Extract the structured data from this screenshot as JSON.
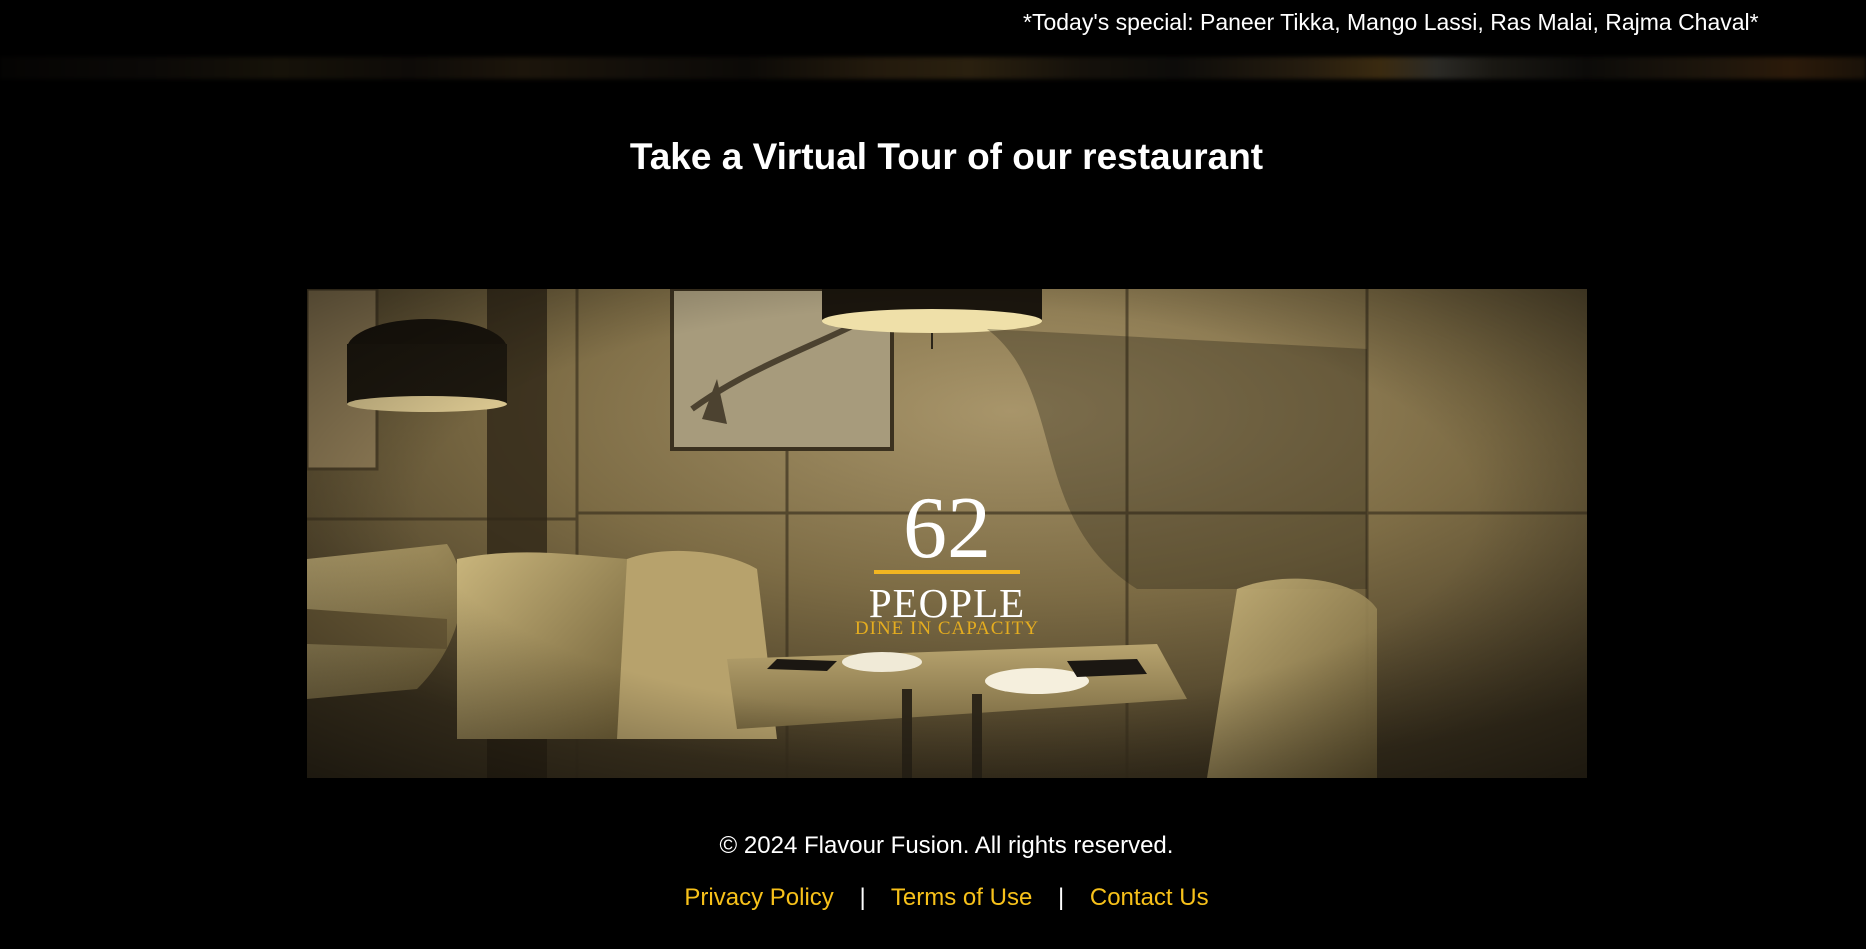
{
  "ticker": {
    "text": "*Today's special: Paneer Tikka, Mango Lassi, Ras Malai, Rajma Chaval*"
  },
  "tour": {
    "title": "Take a Virtual Tour of our restaurant",
    "media": {
      "capacity_number": "62",
      "capacity_label": "PEOPLE",
      "capacity_sublabel": "DINE IN CAPACITY"
    }
  },
  "footer": {
    "copyright": "© 2024 Flavour Fusion. All rights reserved.",
    "links": [
      {
        "label": "Privacy Policy"
      },
      {
        "label": "Terms of Use"
      },
      {
        "label": "Contact Us"
      }
    ],
    "separator": "|"
  },
  "colors": {
    "background": "#000000",
    "accent": "#f7c11a",
    "text": "#ffffff"
  }
}
